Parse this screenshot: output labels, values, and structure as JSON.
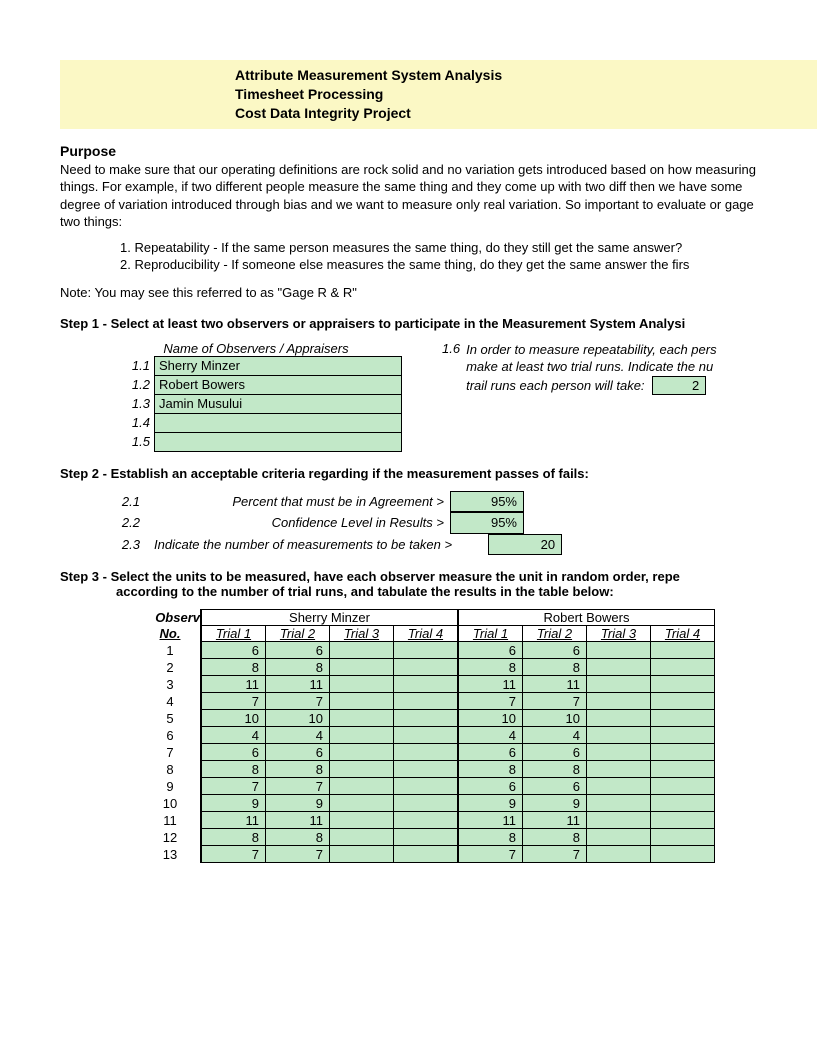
{
  "header": {
    "line1": "Attribute Measurement System Analysis",
    "line2": "Timesheet Processing",
    "line3": "Cost Data Integrity Project"
  },
  "purpose": {
    "title": "Purpose",
    "text": "Need to make sure that our operating definitions are rock solid and no variation gets introduced based on how measuring things. For example, if two different people measure the same thing and they come up with two diff then we have some degree of variation introduced through bias and we want to measure only real variation. So important to evaluate or gage two things:",
    "item1": "1. Repeatability - If the same person measures the same thing, do they still get the same answer?",
    "item2": "2. Reproducibility - If someone else measures the same thing, do they get the same answer the firs",
    "note": "Note: You may see this referred to as \"Gage R & R\""
  },
  "step1": {
    "label": "Step 1 - Select at least two observers or appraisers to participate in the Measurement System Analysi",
    "table_title": "Name of Observers / Appraisers",
    "rows": [
      {
        "num": "1.1",
        "name": "Sherry Minzer"
      },
      {
        "num": "1.2",
        "name": "Robert Bowers"
      },
      {
        "num": "1.3",
        "name": "Jamin Musului"
      },
      {
        "num": "1.4",
        "name": ""
      },
      {
        "num": "1.5",
        "name": ""
      }
    ],
    "note_num": "1.6",
    "note_text_a": "In order to measure repeatability, each pers",
    "note_text_b": "make at least two trial runs. Indicate the nu",
    "note_text_c": "trail runs each person will take:",
    "trial_runs": "2"
  },
  "step2": {
    "label": "Step 2 - Establish an acceptable criteria regarding if the measurement passes of fails:",
    "r1_num": "2.1",
    "r1_label": "Percent that must be in Agreement >",
    "r1_val": "95%",
    "r2_num": "2.2",
    "r2_label": "Confidence Level in Results >",
    "r2_val": "95%",
    "r3_num": "2.3",
    "r3_label": "Indicate the number of measurements to be taken >",
    "r3_val": "20"
  },
  "step3": {
    "label_a": "Step 3 - Select the units to be measured, have each observer measure the unit in random order, repe",
    "label_b": "according to the number of trial runs, and tabulate the results in the table below:",
    "observ": "Observ",
    "no": "No.",
    "persons": [
      "Sherry Minzer",
      "Robert Bowers"
    ],
    "trials": [
      "Trial 1",
      "Trial 2",
      "Trial 3",
      "Trial 4"
    ],
    "data": [
      {
        "n": "1",
        "a": [
          "6",
          "6",
          "",
          ""
        ],
        "b": [
          "6",
          "6",
          "",
          ""
        ]
      },
      {
        "n": "2",
        "a": [
          "8",
          "8",
          "",
          ""
        ],
        "b": [
          "8",
          "8",
          "",
          ""
        ]
      },
      {
        "n": "3",
        "a": [
          "11",
          "11",
          "",
          ""
        ],
        "b": [
          "11",
          "11",
          "",
          ""
        ]
      },
      {
        "n": "4",
        "a": [
          "7",
          "7",
          "",
          ""
        ],
        "b": [
          "7",
          "7",
          "",
          ""
        ]
      },
      {
        "n": "5",
        "a": [
          "10",
          "10",
          "",
          ""
        ],
        "b": [
          "10",
          "10",
          "",
          ""
        ]
      },
      {
        "n": "6",
        "a": [
          "4",
          "4",
          "",
          ""
        ],
        "b": [
          "4",
          "4",
          "",
          ""
        ]
      },
      {
        "n": "7",
        "a": [
          "6",
          "6",
          "",
          ""
        ],
        "b": [
          "6",
          "6",
          "",
          ""
        ]
      },
      {
        "n": "8",
        "a": [
          "8",
          "8",
          "",
          ""
        ],
        "b": [
          "8",
          "8",
          "",
          ""
        ]
      },
      {
        "n": "9",
        "a": [
          "7",
          "7",
          "",
          ""
        ],
        "b": [
          "6",
          "6",
          "",
          ""
        ]
      },
      {
        "n": "10",
        "a": [
          "9",
          "9",
          "",
          ""
        ],
        "b": [
          "9",
          "9",
          "",
          ""
        ]
      },
      {
        "n": "11",
        "a": [
          "11",
          "11",
          "",
          ""
        ],
        "b": [
          "11",
          "11",
          "",
          ""
        ]
      },
      {
        "n": "12",
        "a": [
          "8",
          "8",
          "",
          ""
        ],
        "b": [
          "8",
          "8",
          "",
          ""
        ]
      },
      {
        "n": "13",
        "a": [
          "7",
          "7",
          "",
          ""
        ],
        "b": [
          "7",
          "7",
          "",
          ""
        ]
      }
    ]
  }
}
